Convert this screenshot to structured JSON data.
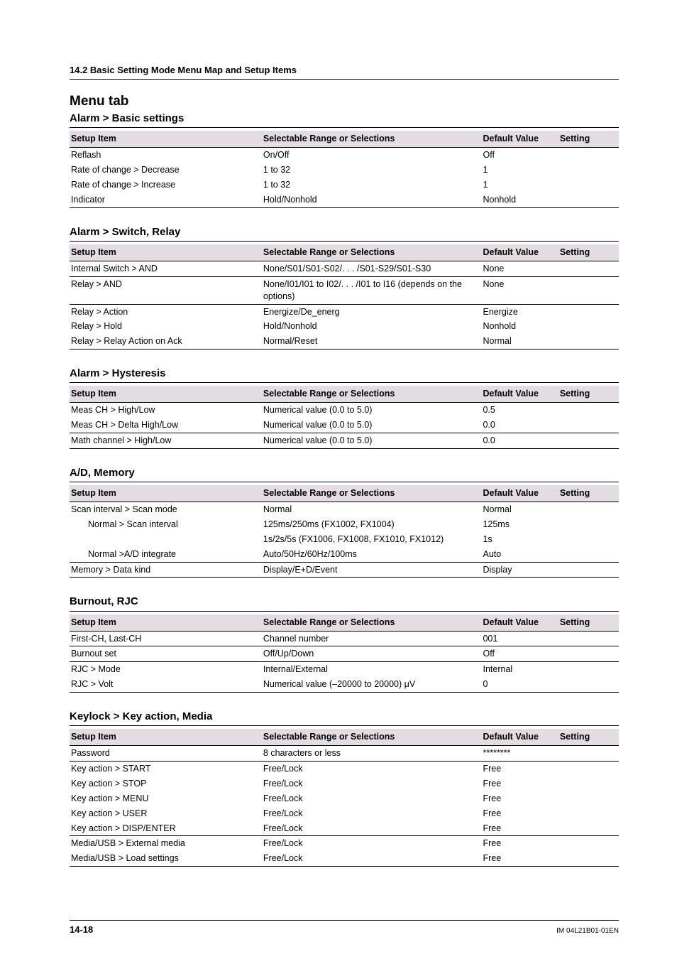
{
  "header": {
    "breadcrumb": "14.2  Basic Setting Mode Menu Map and Setup Items",
    "menu_tab": "Menu tab"
  },
  "columns": {
    "setup_item": "Setup Item",
    "selectable": "Selectable Range or Selections",
    "default": "Default Value",
    "setting": "Setting"
  },
  "sections": [
    {
      "title": "Alarm > Basic settings",
      "rows": [
        {
          "item": "Reflash",
          "sel": "On/Off",
          "def": "Off",
          "brk": false
        },
        {
          "item": "Rate of change > Decrease",
          "sel": "1 to 32",
          "def": "1",
          "brk": false
        },
        {
          "item": "Rate of change > Increase",
          "sel": "1 to 32",
          "def": "1",
          "brk": false
        },
        {
          "item": "Indicator",
          "sel": "Hold/Nonhold",
          "def": "Nonhold",
          "brk": true
        }
      ]
    },
    {
      "title": "Alarm > Switch, Relay",
      "rows": [
        {
          "item": "Internal Switch > AND",
          "sel": "None/S01/S01-S02/. . . /S01-S29/S01-S30",
          "def": "None",
          "brk": true
        },
        {
          "item": "Relay > AND",
          "sel": "None/I01/I01 to I02/. . . /I01 to I16 (depends on the options)",
          "def": "None",
          "brk": true
        },
        {
          "item": "Relay > Action",
          "sel": "Energize/De_energ",
          "def": "Energize",
          "brk": false
        },
        {
          "item": "Relay > Hold",
          "sel": "Hold/Nonhold",
          "def": "Nonhold",
          "brk": false
        },
        {
          "item": "Relay > Relay Action on Ack",
          "sel": "Normal/Reset",
          "def": "Normal",
          "brk": true
        }
      ]
    },
    {
      "title": "Alarm > Hysteresis",
      "rows": [
        {
          "item": "Meas CH > High/Low",
          "sel": "Numerical value (0.0 to 5.0)",
          "def": "0.5",
          "brk": false
        },
        {
          "item": "Meas CH > Delta High/Low",
          "sel": "Numerical value (0.0 to 5.0)",
          "def": "0.0",
          "brk": true
        },
        {
          "item": "Math channel > High/Low",
          "sel": "Numerical value (0.0 to 5.0)",
          "def": "0.0",
          "brk": true
        }
      ]
    },
    {
      "title": "A/D, Memory",
      "rows": [
        {
          "item": "Scan interval > Scan mode",
          "sel": "Normal",
          "def": "Normal",
          "brk": false
        },
        {
          "item": "Normal > Scan interval",
          "indent": 1,
          "sel": "125ms/250ms (FX1002, FX1004)",
          "def": "125ms",
          "brk": false
        },
        {
          "item": "",
          "sel": "1s/2s/5s (FX1006, FX1008, FX1010, FX1012)",
          "def": "1s",
          "brk": false
        },
        {
          "item": "Normal >A/D integrate",
          "indent": 1,
          "sel": "Auto/50Hz/60Hz/100ms",
          "def": "Auto",
          "brk": true
        },
        {
          "item": "Memory > Data kind",
          "sel": "Display/E+D/Event",
          "def": "Display",
          "brk": true
        }
      ]
    },
    {
      "title": "Burnout, RJC",
      "rows": [
        {
          "item": "First-CH, Last-CH",
          "sel": "Channel number",
          "def": "001",
          "brk": true
        },
        {
          "item": "Burnout set",
          "sel": "Off/Up/Down",
          "def": "Off",
          "brk": true
        },
        {
          "item": "RJC > Mode",
          "sel": "Internal/External",
          "def": "Internal",
          "brk": false
        },
        {
          "item": "RJC > Volt",
          "sel": "Numerical value (–20000 to 20000) μV",
          "def": "0",
          "brk": true
        }
      ]
    },
    {
      "title": "Keylock > Key action, Media",
      "rows": [
        {
          "item": "Password",
          "sel": "8 characters or less",
          "def": "********",
          "brk": true
        },
        {
          "item": "Key action > START",
          "sel": "Free/Lock",
          "def": "Free",
          "brk": false
        },
        {
          "item": "Key action > STOP",
          "sel": "Free/Lock",
          "def": "Free",
          "brk": false
        },
        {
          "item": "Key action > MENU",
          "sel": "Free/Lock",
          "def": "Free",
          "brk": false
        },
        {
          "item": "Key action > USER",
          "sel": "Free/Lock",
          "def": "Free",
          "brk": false
        },
        {
          "item": "Key action > DISP/ENTER",
          "sel": "Free/Lock",
          "def": "Free",
          "brk": true
        },
        {
          "item": "Media/USB > External media",
          "sel": "Free/Lock",
          "def": "Free",
          "brk": false
        },
        {
          "item": "Media/USB > Load settings",
          "sel": "Free/Lock",
          "def": "Free",
          "brk": true
        }
      ]
    }
  ],
  "footer": {
    "page": "14-18",
    "docid": "IM 04L21B01-01EN"
  }
}
